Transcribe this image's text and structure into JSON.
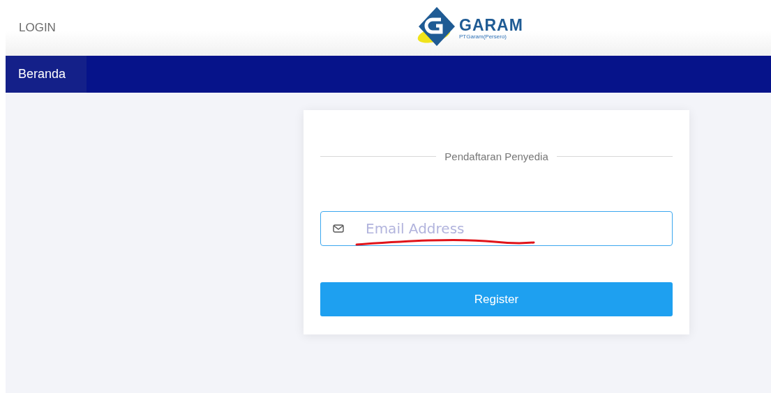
{
  "header": {
    "login_link": "LOGIN",
    "logo": {
      "name": "GARAM",
      "subtitle": "PTGaram(Persero)"
    }
  },
  "nav": {
    "items": [
      {
        "label": "Beranda",
        "selected": true
      }
    ]
  },
  "form": {
    "title": "Pendaftaran Penyedia",
    "email": {
      "placeholder": "Email Address"
    },
    "submit": "Register"
  }
}
